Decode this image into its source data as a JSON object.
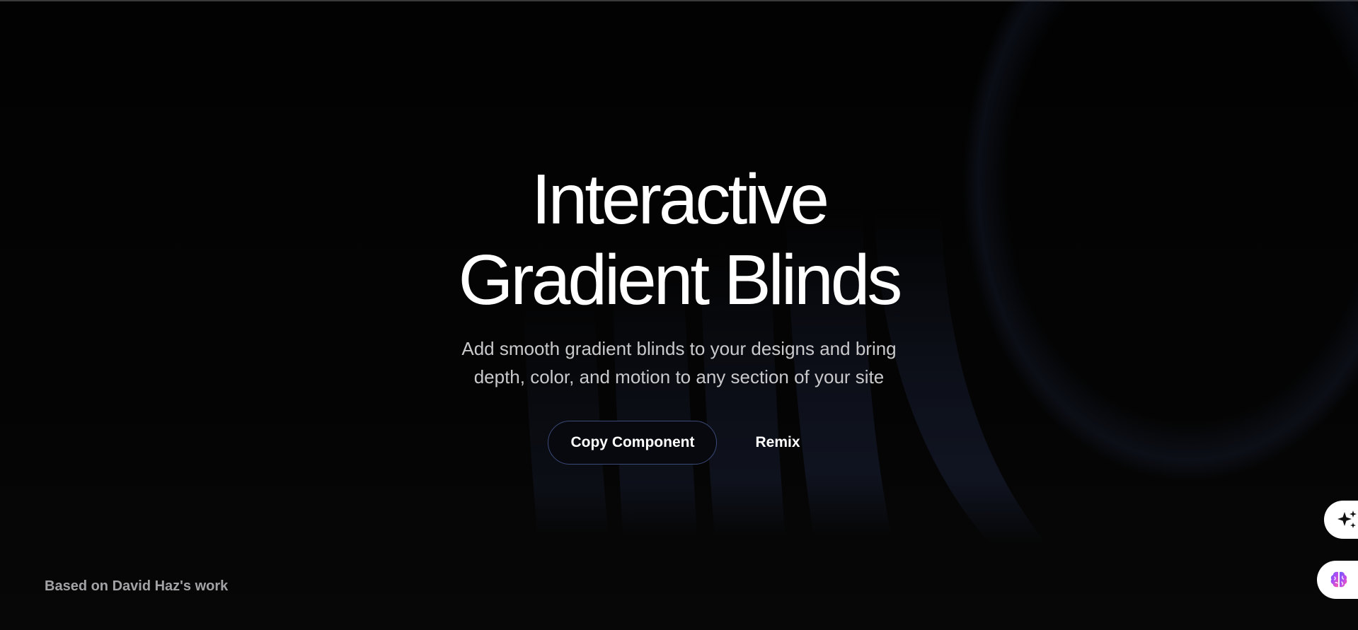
{
  "hero": {
    "title_line1": "Interactive",
    "title_line2": "Gradient Blinds",
    "subtitle_line1": "Add smooth gradient blinds to your designs and bring",
    "subtitle_line2": "depth, color, and motion to any section of your site"
  },
  "actions": {
    "copy_label": "Copy Component",
    "remix_label": "Remix"
  },
  "footer": {
    "credit": "Based on David Haz's work"
  },
  "floating": {
    "top_icon": "sparkles-icon",
    "bottom_icon": "brain-icon"
  },
  "colors": {
    "background": "#030303",
    "button_border": "#3b4a78",
    "blind_tint": "#1c2540",
    "text_primary": "#ffffff",
    "text_muted": "#c9c9cc"
  }
}
